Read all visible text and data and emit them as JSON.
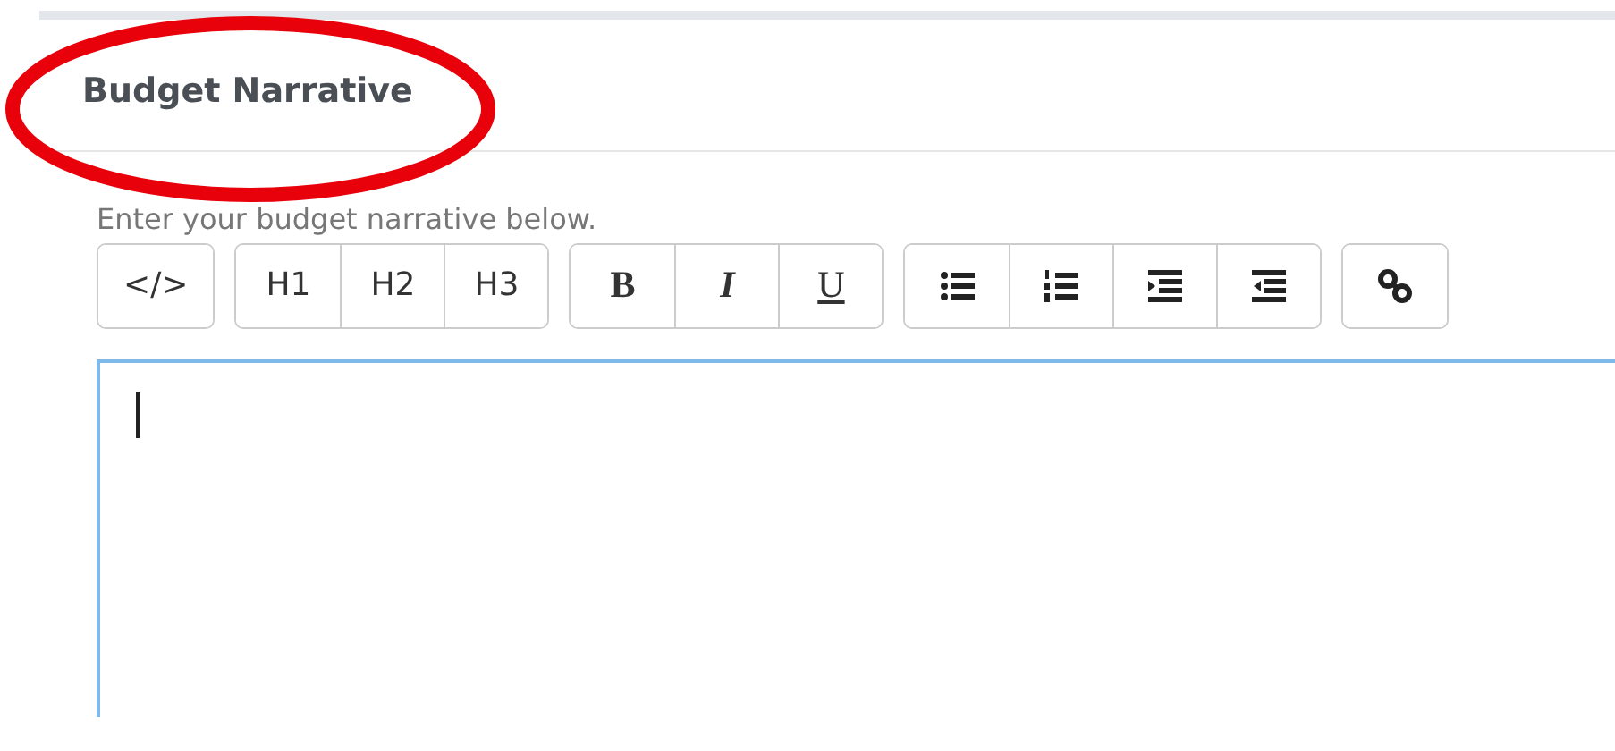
{
  "heading": "Budget Narrative",
  "annotation": {
    "kind": "ellipse"
  },
  "hint": "Enter your budget narrative below.",
  "toolbar": [
    {
      "buttons": [
        {
          "kind": "text",
          "label": "</>"
        }
      ]
    },
    {
      "buttons": [
        {
          "kind": "text",
          "label": "H1"
        },
        {
          "kind": "text",
          "label": "H2"
        },
        {
          "kind": "text",
          "label": "H3"
        }
      ]
    },
    {
      "buttons": [
        {
          "kind": "bold",
          "label": "B"
        },
        {
          "kind": "italic",
          "label": "I"
        },
        {
          "kind": "underline",
          "label": "U"
        }
      ]
    },
    {
      "buttons": [
        {
          "kind": "bullets"
        },
        {
          "kind": "numbers"
        },
        {
          "kind": "indent"
        },
        {
          "kind": "outdent"
        }
      ]
    },
    {
      "buttons": [
        {
          "kind": "link"
        }
      ]
    }
  ],
  "editor": {
    "focused": true
  }
}
